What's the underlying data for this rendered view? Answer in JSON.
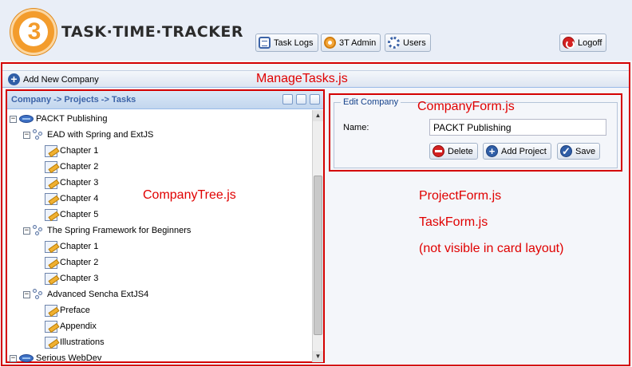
{
  "header": {
    "logo_text": "3",
    "app_title": "TASK·TIME·TRACKER",
    "nav": [
      {
        "label": "Task Logs",
        "icon": "task-logs-icon"
      },
      {
        "label": "3T Admin",
        "icon": "admin-icon"
      },
      {
        "label": "Users",
        "icon": "users-icon"
      }
    ],
    "logoff_label": "Logoff"
  },
  "toolbar": {
    "add_company_label": "Add New Company"
  },
  "annotations": {
    "manage_tasks": "ManageTasks.js",
    "company_tree": "CompanyTree.js",
    "company_form": "CompanyForm.js",
    "project_form": "ProjectForm.js",
    "task_form": "TaskForm.js",
    "not_visible": "(not visible in card layout)"
  },
  "tree": {
    "title": "Company -> Projects -> Tasks",
    "nodes": [
      {
        "label": "PACKT Publishing",
        "type": "company",
        "expanded": true
      },
      {
        "label": "EAD with Spring and ExtJS",
        "type": "project",
        "expanded": true
      },
      {
        "label": "Chapter 1",
        "type": "task"
      },
      {
        "label": "Chapter 2",
        "type": "task"
      },
      {
        "label": "Chapter 3",
        "type": "task"
      },
      {
        "label": "Chapter 4",
        "type": "task"
      },
      {
        "label": "Chapter 5",
        "type": "task"
      },
      {
        "label": "The Spring Framework for Beginners",
        "type": "project",
        "expanded": true
      },
      {
        "label": "Chapter 1",
        "type": "task"
      },
      {
        "label": "Chapter 2",
        "type": "task"
      },
      {
        "label": "Chapter 3",
        "type": "task"
      },
      {
        "label": "Advanced Sencha ExtJS4",
        "type": "project",
        "expanded": true
      },
      {
        "label": "Preface",
        "type": "task"
      },
      {
        "label": "Appendix",
        "type": "task"
      },
      {
        "label": "Illustrations",
        "type": "task"
      },
      {
        "label": "Serious WebDev",
        "type": "company",
        "expanded": true
      }
    ]
  },
  "company_form": {
    "legend": "Edit Company",
    "name_label": "Name:",
    "name_value": "PACKT Publishing",
    "delete_label": "Delete",
    "add_project_label": "Add Project",
    "save_label": "Save"
  },
  "colors": {
    "annotation_red": "#e00000",
    "header_blue": "#3d64a8",
    "logo_orange": "#f39c2c"
  }
}
